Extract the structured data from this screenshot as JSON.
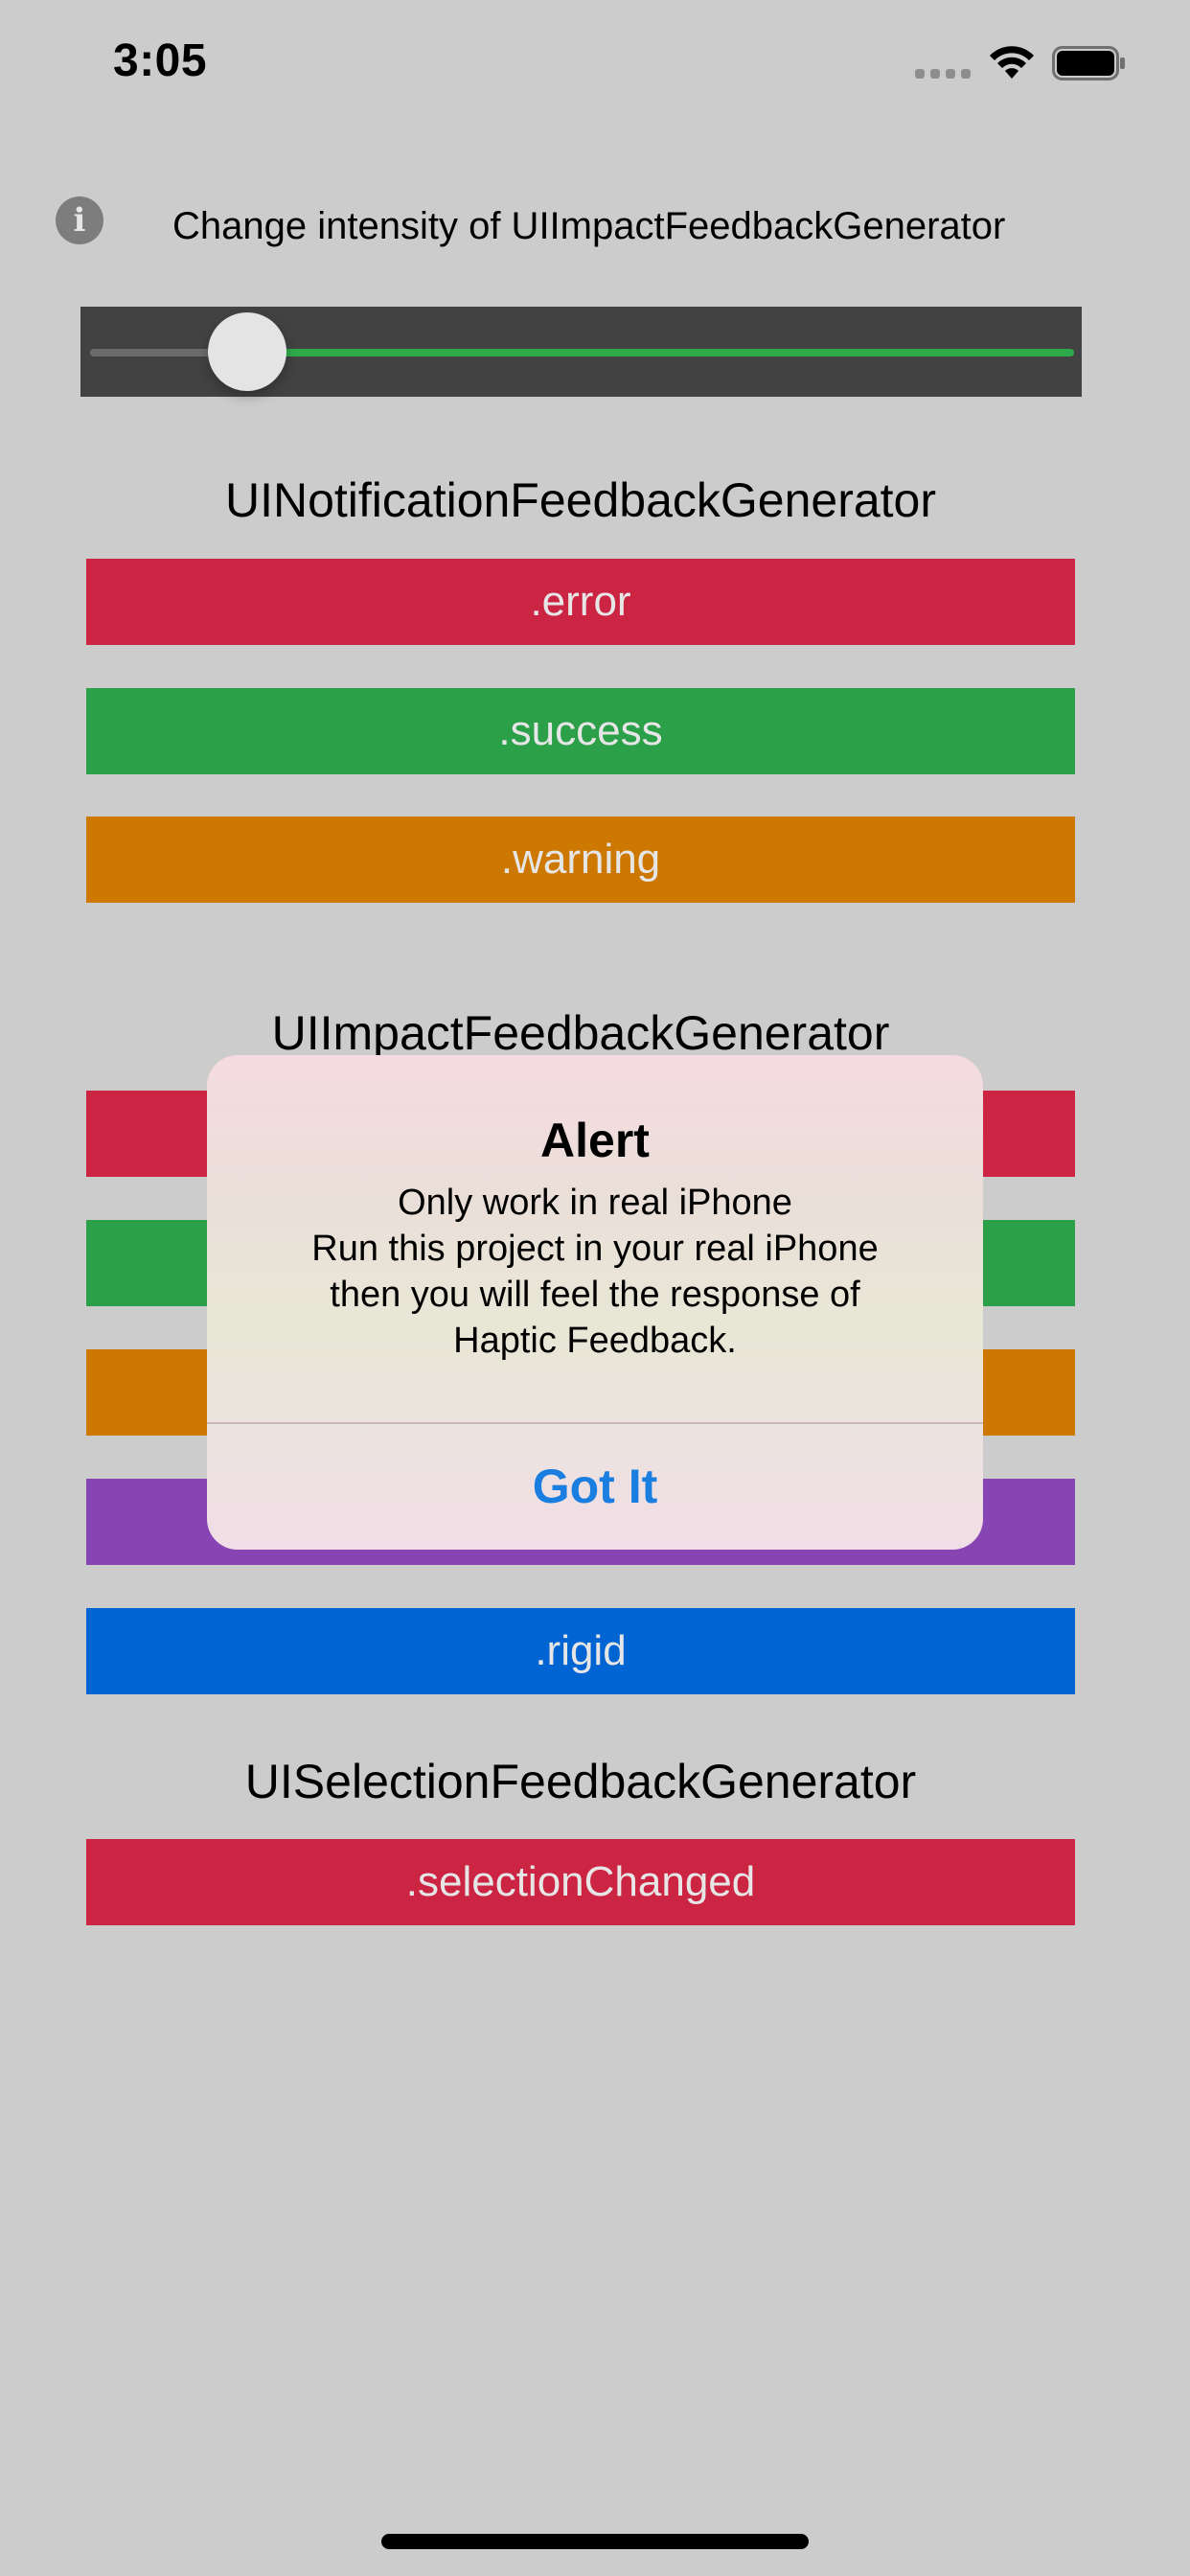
{
  "status_bar": {
    "time": "3:05"
  },
  "intensity": {
    "label": "Change intensity of UIImpactFeedbackGenerator",
    "slider_value": 0.13
  },
  "notification_section": {
    "title": "UINotificationFeedbackGenerator",
    "buttons": [
      {
        "label": ".error",
        "color": "#cc2543"
      },
      {
        "label": ".success",
        "color": "#2ba049"
      },
      {
        "label": ".warning",
        "color": "#cd7800"
      }
    ]
  },
  "impact_section": {
    "title": "UIImpactFeedbackGenerator",
    "buttons": [
      {
        "label": "",
        "color": "#cc2543"
      },
      {
        "label": "",
        "color": "#2ba049"
      },
      {
        "label": "",
        "color": "#cd7800"
      },
      {
        "label": "",
        "color": "#8745b3"
      },
      {
        "label": ".rigid",
        "color": "#0064d2"
      }
    ]
  },
  "selection_section": {
    "title": "UISelectionFeedbackGenerator",
    "buttons": [
      {
        "label": ".selectionChanged",
        "color": "#cc2543"
      }
    ]
  },
  "alert": {
    "title": "Alert",
    "message_lines": [
      "Only work in real iPhone",
      "Run this project in your real iPhone",
      "then you will feel the response of",
      "Haptic Feedback."
    ],
    "button_label": "Got It"
  },
  "colors": {
    "background": "#cccccc",
    "slider_background": "#424242",
    "slider_active": "#2fa84a",
    "alert_action": "#1a7ee0"
  },
  "icons": {
    "info": "info-icon",
    "signal": "cellular-signal-icon",
    "wifi": "wifi-icon",
    "battery": "battery-icon"
  }
}
